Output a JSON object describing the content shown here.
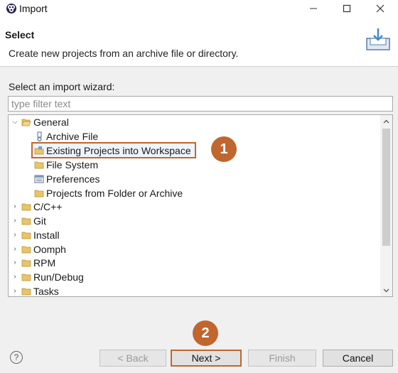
{
  "window": {
    "title": "Import",
    "minimize_icon": "minimize-icon",
    "maximize_icon": "maximize-icon",
    "close_icon": "close-icon"
  },
  "header": {
    "title": "Select",
    "description": "Create new projects from an archive file or directory."
  },
  "wizard": {
    "label": "Select an import wizard:",
    "filter_placeholder": "type filter text",
    "filter_value": ""
  },
  "tree": {
    "items": [
      {
        "label": "General",
        "level": 0,
        "expanded": true,
        "icon": "folder-open-icon"
      },
      {
        "label": "Archive File",
        "level": 1,
        "icon": "archive-icon"
      },
      {
        "label": "Existing Projects into Workspace",
        "level": 1,
        "icon": "project-icon",
        "selected": true
      },
      {
        "label": "File System",
        "level": 1,
        "icon": "folder-icon"
      },
      {
        "label": "Preferences",
        "level": 1,
        "icon": "preferences-icon"
      },
      {
        "label": "Projects from Folder or Archive",
        "level": 1,
        "icon": "folder-icon"
      },
      {
        "label": "C/C++",
        "level": 0,
        "expanded": false,
        "icon": "folder-icon"
      },
      {
        "label": "Git",
        "level": 0,
        "expanded": false,
        "icon": "folder-icon"
      },
      {
        "label": "Install",
        "level": 0,
        "expanded": false,
        "icon": "folder-icon"
      },
      {
        "label": "Oomph",
        "level": 0,
        "expanded": false,
        "icon": "folder-icon"
      },
      {
        "label": "RPM",
        "level": 0,
        "expanded": false,
        "icon": "folder-icon"
      },
      {
        "label": "Run/Debug",
        "level": 0,
        "expanded": false,
        "icon": "folder-icon"
      },
      {
        "label": "Tasks",
        "level": 0,
        "expanded": false,
        "icon": "folder-icon"
      }
    ]
  },
  "annotations": {
    "step1": "1",
    "step2": "2",
    "color": "#c0662e"
  },
  "footer": {
    "help": "?",
    "back": "< Back",
    "next": "Next >",
    "finish": "Finish",
    "cancel": "Cancel"
  }
}
